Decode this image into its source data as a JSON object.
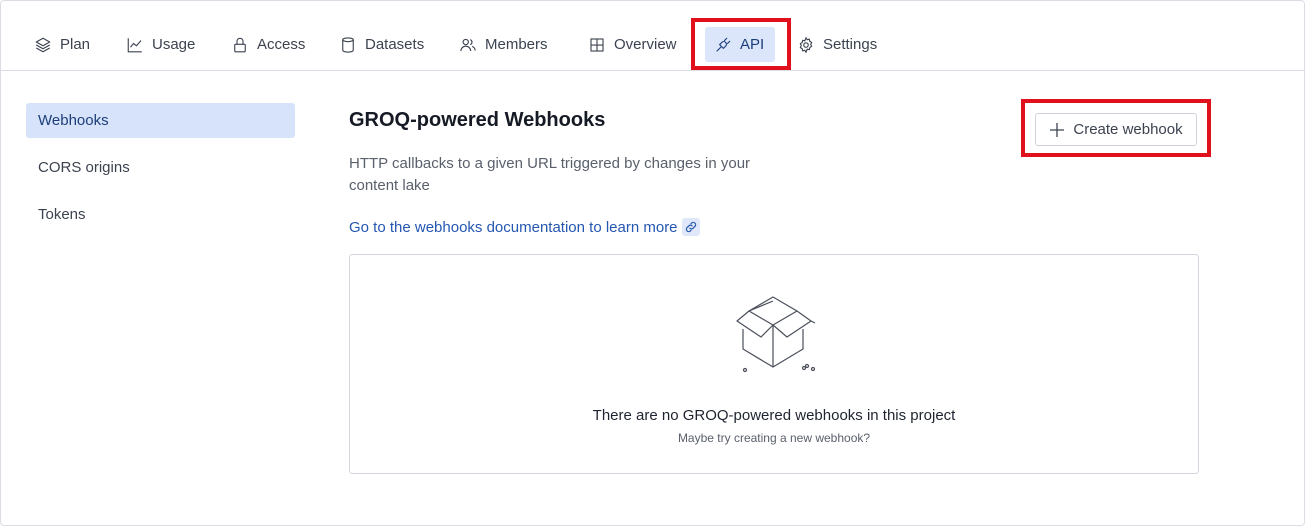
{
  "tabs": [
    {
      "label": "Plan",
      "icon": "layers-icon"
    },
    {
      "label": "Usage",
      "icon": "chart-line-icon"
    },
    {
      "label": "Access",
      "icon": "lock-icon"
    },
    {
      "label": "Datasets",
      "icon": "database-icon"
    },
    {
      "label": "Members",
      "icon": "users-icon"
    },
    {
      "label": "Overview",
      "icon": "grid-icon"
    },
    {
      "label": "API",
      "icon": "plug-icon",
      "active": true
    },
    {
      "label": "Settings",
      "icon": "gear-icon"
    }
  ],
  "sidebar": {
    "items": [
      {
        "label": "Webhooks",
        "active": true
      },
      {
        "label": "CORS origins"
      },
      {
        "label": "Tokens"
      }
    ]
  },
  "main": {
    "title": "GROQ-powered Webhooks",
    "description": "HTTP callbacks to a given URL triggered by changes in your content lake",
    "doc_link": "Go to the webhooks documentation to learn more",
    "create_button": "Create webhook",
    "empty_state": {
      "title": "There are no GROQ-powered webhooks in this project",
      "subtitle": "Maybe try creating a new webhook?"
    }
  },
  "colors": {
    "accent": "#2457b0",
    "active_bg": "#dbe6fb",
    "highlight": "#e0101d"
  }
}
